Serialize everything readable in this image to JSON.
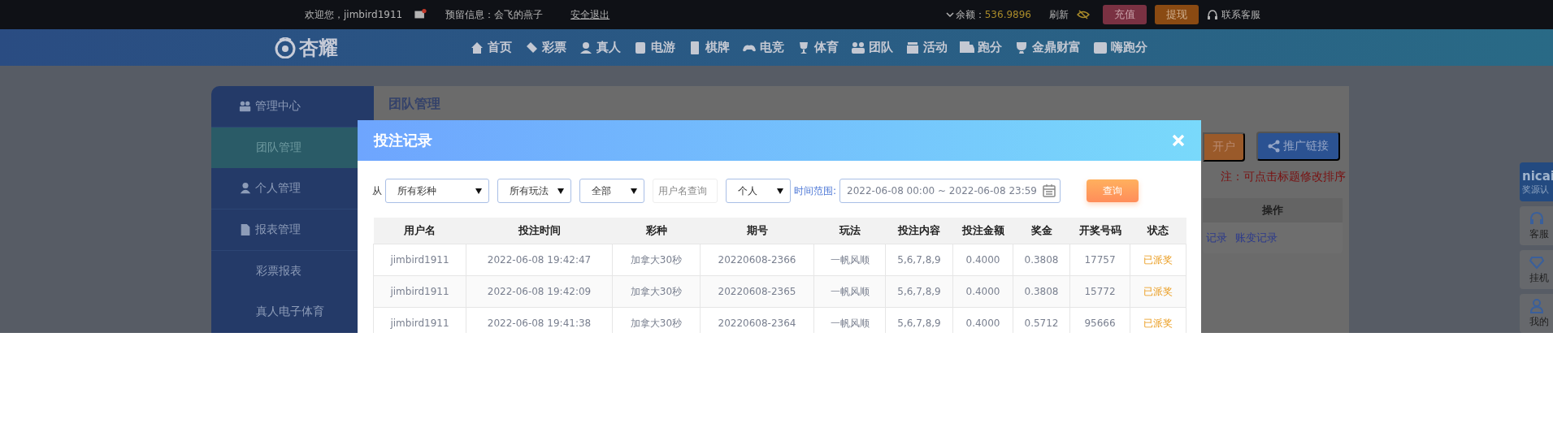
{
  "top_bar": {
    "welcome": "欢迎您，jimbird1911",
    "reserved_info": "预留信息：会飞的燕子",
    "logout": "安全退出",
    "balance_label": "余额：",
    "balance": "536.9896",
    "refresh": "刷新",
    "deposit": "充值",
    "withdraw": "提现",
    "support": "联系客服"
  },
  "logo": "杏耀",
  "nav": [
    {
      "label": "首页"
    },
    {
      "label": "彩票"
    },
    {
      "label": "真人"
    },
    {
      "label": "电游"
    },
    {
      "label": "棋牌"
    },
    {
      "label": "电竞"
    },
    {
      "label": "体育"
    },
    {
      "label": "团队"
    },
    {
      "label": "活动"
    },
    {
      "label": "跑分"
    },
    {
      "label": "金鼎财富"
    },
    {
      "label": "嗨跑分"
    }
  ],
  "sidebar": {
    "items": [
      {
        "label": "管理中心",
        "kind": "section",
        "selected": false
      },
      {
        "label": "团队管理",
        "kind": "link",
        "selected": true
      },
      {
        "label": "个人管理",
        "kind": "section",
        "selected": false
      },
      {
        "label": "报表管理",
        "kind": "section",
        "selected": false
      },
      {
        "label": "彩票报表",
        "kind": "link",
        "selected": false
      },
      {
        "label": "真人电子体育",
        "kind": "link",
        "selected": false
      }
    ]
  },
  "main": {
    "title": "团队管理",
    "open_account": "开户",
    "promo_link": "推广链接",
    "note": "注：可点击标题修改排序",
    "actions_header": "操作",
    "links": [
      "记录",
      "账变记录"
    ]
  },
  "float_bar": {
    "brand": "nicai",
    "brand_caption": "奖源认",
    "items": [
      {
        "label": "客服"
      },
      {
        "label": "挂机"
      },
      {
        "label": "我的"
      }
    ]
  },
  "modal": {
    "title": "投注记录",
    "from_label": "从",
    "lottery": "所有彩种",
    "play": "所有玩法",
    "status": "全部",
    "user_placeholder": "用户名查询",
    "scope": "个人",
    "range_label": "时间范围:",
    "range": "2022-06-08 00:00 ~ 2022-06-08 23:59",
    "search": "查询",
    "table": {
      "columns": [
        "用户名",
        "投注时间",
        "彩种",
        "期号",
        "玩法",
        "投注内容",
        "投注金额",
        "奖金",
        "开奖号码",
        "状态"
      ],
      "rows": [
        [
          "jimbird1911",
          "2022-06-08 19:42:47",
          "加拿大30秒",
          "20220608-2366",
          "一帆风顺",
          "5,6,7,8,9",
          "0.4000",
          "0.3808",
          "17757",
          "已派奖"
        ],
        [
          "jimbird1911",
          "2022-06-08 19:42:09",
          "加拿大30秒",
          "20220608-2365",
          "一帆风顺",
          "5,6,7,8,9",
          "0.4000",
          "0.3808",
          "15772",
          "已派奖"
        ],
        [
          "jimbird1911",
          "2022-06-08 19:41:38",
          "加拿大30秒",
          "20220608-2364",
          "一帆风顺",
          "5,6,7,8,9",
          "0.4000",
          "0.5712",
          "95666",
          "已派奖"
        ]
      ]
    }
  }
}
